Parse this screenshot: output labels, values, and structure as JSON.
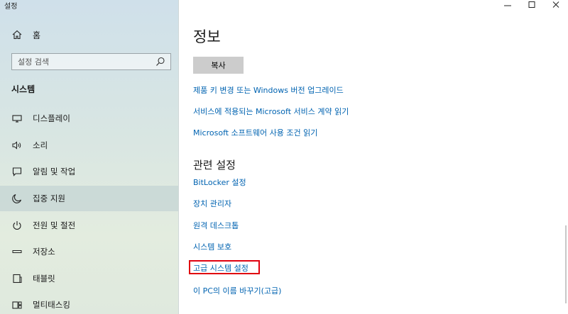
{
  "window": {
    "title": "설정"
  },
  "sidebar": {
    "home_label": "홈",
    "search_placeholder": "설정 검색",
    "section_label": "시스템",
    "items": [
      {
        "label": "디스플레이",
        "icon": "monitor-icon"
      },
      {
        "label": "소리",
        "icon": "speaker-icon"
      },
      {
        "label": "알림 및 작업",
        "icon": "notification-icon"
      },
      {
        "label": "집중 지원",
        "icon": "moon-icon",
        "selected": true
      },
      {
        "label": "전원 및 절전",
        "icon": "power-icon"
      },
      {
        "label": "저장소",
        "icon": "storage-icon"
      },
      {
        "label": "태블릿",
        "icon": "tablet-icon"
      },
      {
        "label": "멀티태스킹",
        "icon": "multitasking-icon"
      }
    ]
  },
  "main": {
    "title": "정보",
    "copy_button": "복사",
    "links": [
      "제품 키 변경 또는 Windows 버전 업그레이드",
      "서비스에 적용되는 Microsoft 서비스 계약 읽기",
      "Microsoft 소프트웨어 사용 조건 읽기"
    ],
    "related_title": "관련 설정",
    "related_links": [
      "BitLocker 설정",
      "장치 관리자",
      "원격 데스크톱",
      "시스템 보호",
      "고급 시스템 설정",
      "이 PC의 이름 바꾸기(고급)"
    ],
    "highlighted_link": "고급 시스템 설정"
  },
  "colors": {
    "link": "#0063b1",
    "highlight": "#e0000f",
    "button": "#cccccc"
  }
}
